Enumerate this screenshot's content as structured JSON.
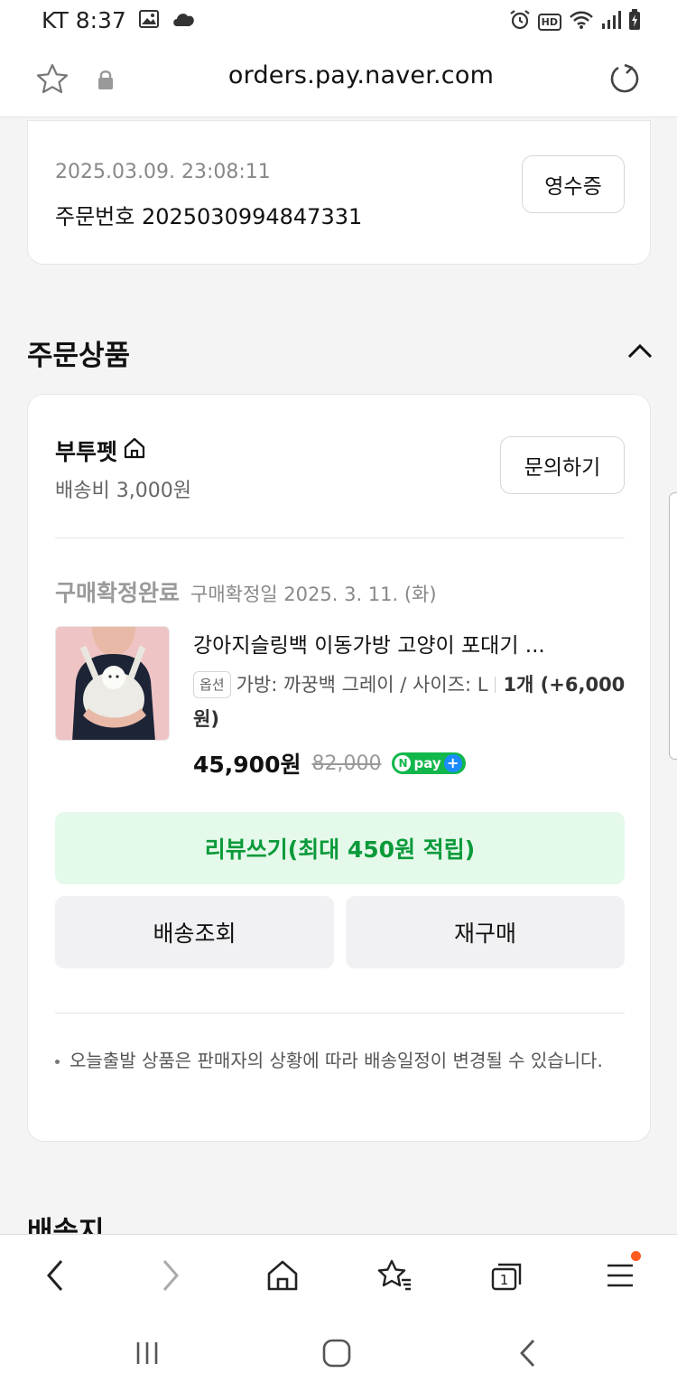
{
  "status_bar": {
    "carrier": "KT",
    "time": "8:37",
    "hd": "HD"
  },
  "browser": {
    "url": "orders.pay.naver.com"
  },
  "order_info": {
    "datetime": "2025.03.09. 23:08:11",
    "order_number": "주문번호 2025030994847331",
    "receipt_label": "영수증"
  },
  "ordered_products": {
    "title": "주문상품",
    "seller": {
      "name": "부투펫",
      "shipping_fee": "배송비 3,000원",
      "inquiry_label": "문의하기"
    },
    "status": {
      "main": "구매확정완료",
      "sub": "구매확정일 2025. 3. 11. (화)"
    },
    "product": {
      "name": "강아지슬링백 이동가방 고양이 포대기 ...",
      "option_badge": "옵션",
      "option_text": "가방: 까꿍백 그레이 / 사이즈: L",
      "quantity_text": "1개 (+6,000원)",
      "price": "45,900원",
      "original_price": "82,000",
      "npay": "pay"
    },
    "review_label": "리뷰쓰기(최대 450원 적립)",
    "track_label": "배송조회",
    "rebuy_label": "재구매",
    "notice": "오늘출발 상품은 판매자의 상황에 따라 배송일정이 변경될 수 있습니다."
  },
  "next_section_title": "배송지",
  "bottom_nav": {
    "tabs_count": "1"
  },
  "colors": {
    "green": "#0b9a3a",
    "review_bg": "#e4f9ea",
    "npay_green": "#12b74c",
    "npay_plus_blue": "#1a8cff",
    "menu_dot": "#ff5b1f"
  }
}
